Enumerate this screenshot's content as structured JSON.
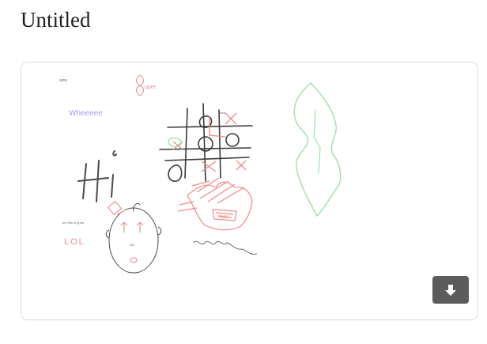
{
  "page": {
    "title": "Untitled"
  },
  "drawing": {
    "texts": {
      "wheeeee": "Wheeeee",
      "lol": "LOL",
      "hi": "Hi",
      "tiny_top": "wow",
      "tiny_label": "but this is great",
      "super": "uper",
      "nose": "NO",
      "mouth": "RAB"
    },
    "colors": {
      "purple": "#a89cf0",
      "red": "#f08a8a",
      "green": "#9fe0a8",
      "dark": "#4a4a4a",
      "gray": "#8a8a8a",
      "pink": "#f0a0b0"
    }
  },
  "toolbar": {
    "download_icon": "download-arrow-icon"
  }
}
